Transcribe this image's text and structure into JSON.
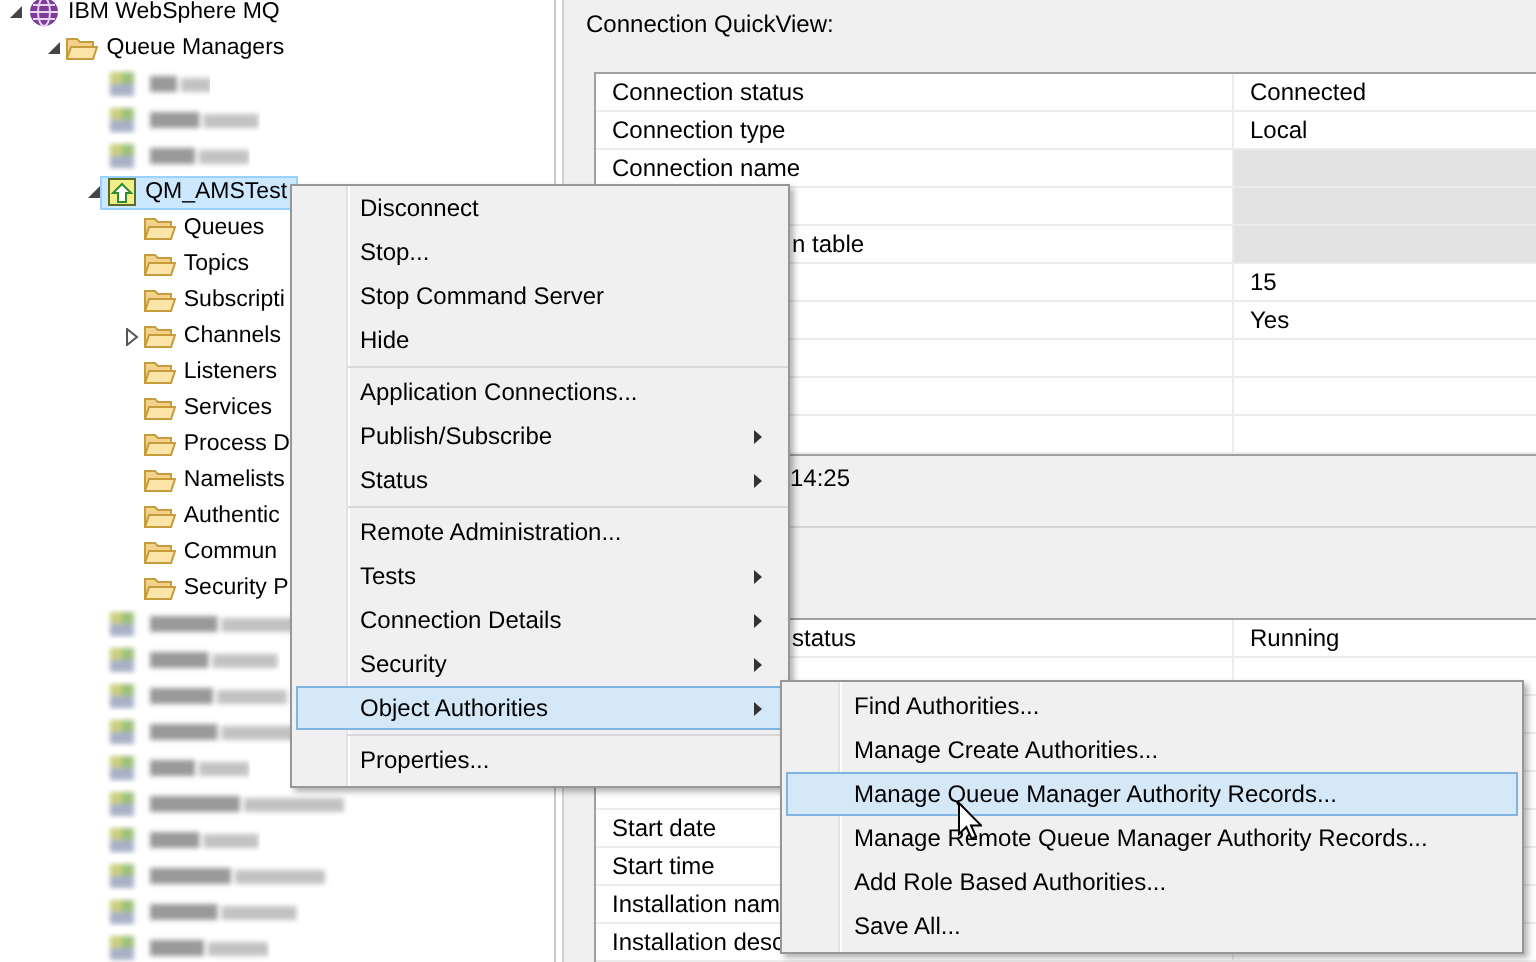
{
  "tree": {
    "label": "IBM WebSphere MQ",
    "kind": "root",
    "expanded": true,
    "selected": false,
    "children": [
      {
        "label": "Queue Managers",
        "kind": "folder",
        "expanded": true,
        "selected": false,
        "children": [
          {
            "kind": "blurred",
            "selected": false
          },
          {
            "kind": "blurred",
            "selected": false
          },
          {
            "kind": "blurred",
            "selected": false
          },
          {
            "label": "QM_AMSTest",
            "kind": "qmgr",
            "expanded": true,
            "selected": true,
            "children": [
              {
                "label": "Queues",
                "kind": "folder",
                "selected": false
              },
              {
                "label": "Topics",
                "kind": "folder",
                "selected": false
              },
              {
                "label": "Subscripti",
                "kind": "folder",
                "selected": false
              },
              {
                "label": "Channels",
                "kind": "folder",
                "expanded": false,
                "selected": false
              },
              {
                "label": "Listeners",
                "kind": "folder",
                "selected": false
              },
              {
                "label": "Services",
                "kind": "folder",
                "selected": false
              },
              {
                "label": "Process D",
                "kind": "folder",
                "selected": false
              },
              {
                "label": "Namelists",
                "kind": "folder",
                "selected": false
              },
              {
                "label": "Authentic",
                "kind": "folder",
                "selected": false
              },
              {
                "label": "Commun",
                "kind": "folder",
                "selected": false
              },
              {
                "label": "Security P",
                "kind": "folder",
                "selected": false
              }
            ]
          },
          {
            "kind": "blurred",
            "selected": false
          },
          {
            "kind": "blurred",
            "selected": false
          },
          {
            "kind": "blurred",
            "selected": false
          },
          {
            "kind": "blurred",
            "selected": false
          },
          {
            "kind": "blurred",
            "selected": false
          },
          {
            "kind": "blurred",
            "selected": false
          },
          {
            "kind": "blurred",
            "selected": false
          },
          {
            "kind": "blurred",
            "selected": false
          },
          {
            "kind": "blurred",
            "selected": false
          },
          {
            "kind": "blurred",
            "selected": false
          }
        ]
      }
    ]
  },
  "quickview": {
    "title": "Connection QuickView:",
    "rows": [
      {
        "kind": "text",
        "label": "Connection status",
        "value": "Connected",
        "disabled": false
      },
      {
        "kind": "text",
        "label": "Connection type",
        "value": "Local",
        "disabled": false
      },
      {
        "kind": "text",
        "label": "Connection name",
        "disabled": true
      },
      {
        "kind": "text",
        "disabled": true
      },
      {
        "kind": "partial",
        "label": "n table",
        "disabled": true
      },
      {
        "kind": "text",
        "value": "15",
        "disabled": false
      },
      {
        "kind": "text",
        "value": "Yes",
        "disabled": false
      },
      {
        "kind": "blank",
        "disabled": false
      },
      {
        "kind": "blank",
        "disabled": false
      },
      {
        "kind": "blank",
        "disabled": false
      }
    ],
    "timestamp": "14:25"
  },
  "status_table": {
    "rows": [
      {
        "kind": "partial",
        "label": "status",
        "value": "Running"
      },
      {
        "kind": "blank"
      },
      {
        "kind": "blank"
      },
      {
        "kind": "blank"
      },
      {
        "kind": "blank"
      },
      {
        "kind": "text",
        "label": "Start date"
      },
      {
        "kind": "text",
        "label": "Start time"
      },
      {
        "kind": "text",
        "label": "Installation nam"
      },
      {
        "kind": "text",
        "label": "Installation desc"
      }
    ]
  },
  "context_menu": {
    "items": [
      {
        "kind": "item",
        "label": "Disconnect",
        "submenu": false,
        "selected": false
      },
      {
        "kind": "item",
        "label": "Stop...",
        "submenu": false,
        "selected": false
      },
      {
        "kind": "item",
        "label": "Stop Command Server",
        "submenu": false,
        "selected": false
      },
      {
        "kind": "item",
        "label": "Hide",
        "submenu": false,
        "selected": false
      },
      {
        "kind": "separator"
      },
      {
        "kind": "item",
        "label": "Application Connections...",
        "submenu": false,
        "selected": false
      },
      {
        "kind": "item",
        "label": "Publish/Subscribe",
        "submenu": true,
        "selected": false
      },
      {
        "kind": "item",
        "label": "Status",
        "submenu": true,
        "selected": false
      },
      {
        "kind": "separator"
      },
      {
        "kind": "item",
        "label": "Remote Administration...",
        "submenu": false,
        "selected": false
      },
      {
        "kind": "item",
        "label": "Tests",
        "submenu": true,
        "selected": false
      },
      {
        "kind": "item",
        "label": "Connection Details",
        "submenu": true,
        "selected": false
      },
      {
        "kind": "item",
        "label": "Security",
        "submenu": true,
        "selected": false
      },
      {
        "kind": "item",
        "label": "Object Authorities",
        "submenu": true,
        "selected": true
      },
      {
        "kind": "separator"
      },
      {
        "kind": "item",
        "label": "Properties...",
        "submenu": false,
        "selected": false
      }
    ]
  },
  "submenu": {
    "items": [
      {
        "kind": "item",
        "label": "Find Authorities...",
        "submenu": false,
        "selected": false
      },
      {
        "kind": "item",
        "label": "Manage Create Authorities...",
        "submenu": false,
        "selected": false
      },
      {
        "kind": "item",
        "label": "Manage Queue Manager Authority Records...",
        "submenu": false,
        "selected": true
      },
      {
        "kind": "item",
        "label": "Manage Remote Queue Manager Authority Records...",
        "submenu": false,
        "selected": false
      },
      {
        "kind": "item",
        "label": "Add Role Based Authorities...",
        "submenu": false,
        "selected": false
      },
      {
        "kind": "item",
        "label": "Save All...",
        "submenu": false,
        "selected": false
      }
    ]
  }
}
